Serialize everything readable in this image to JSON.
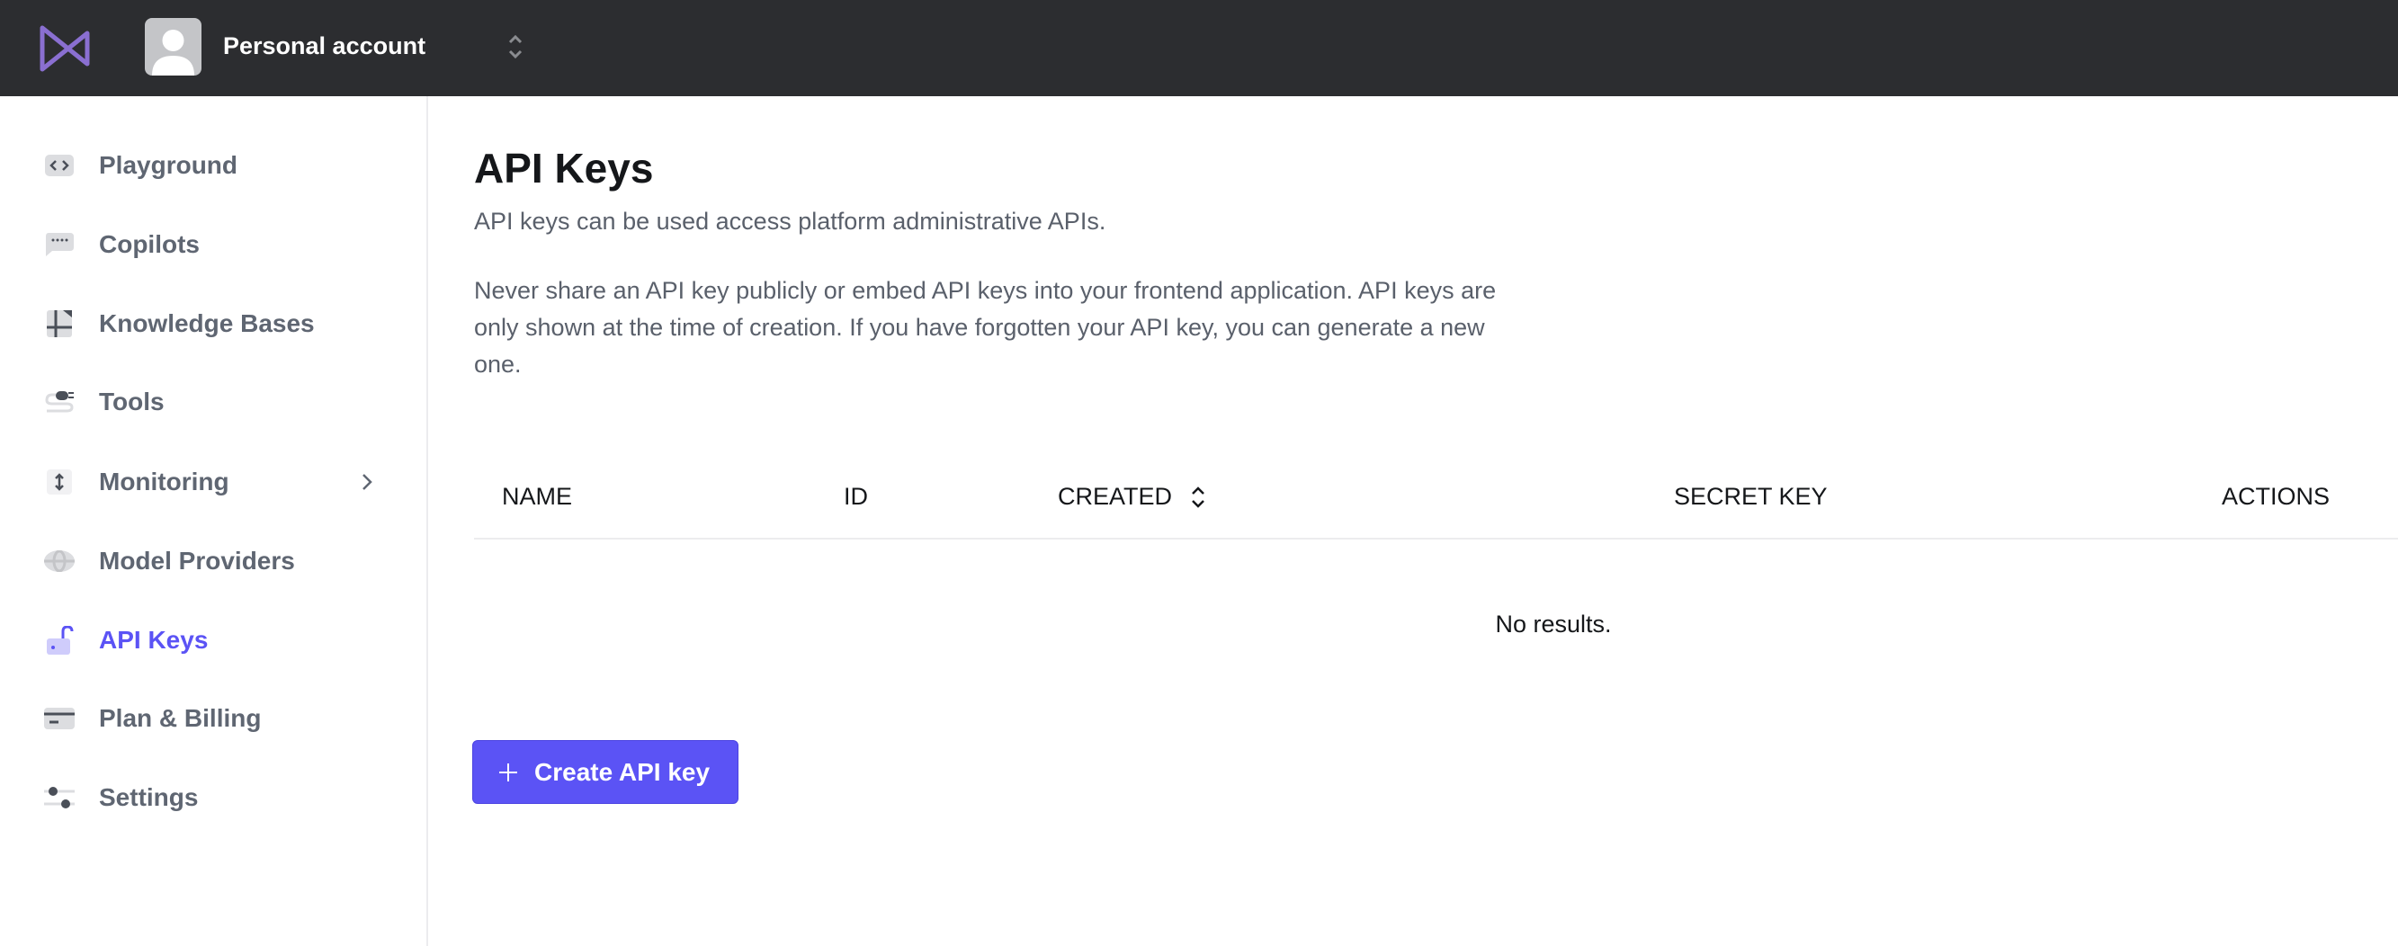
{
  "topbar": {
    "account_name": "Personal account",
    "logo_color": "#8a6fd1"
  },
  "sidebar": {
    "items": [
      {
        "label": "Playground",
        "icon": "code-icon"
      },
      {
        "label": "Copilots",
        "icon": "chat-icon"
      },
      {
        "label": "Knowledge Bases",
        "icon": "book-icon"
      },
      {
        "label": "Tools",
        "icon": "plug-icon"
      },
      {
        "label": "Monitoring",
        "icon": "arrows-icon",
        "has_submenu": true
      },
      {
        "label": "Model Providers",
        "icon": "globe-icon"
      },
      {
        "label": "API Keys",
        "icon": "lock-open-icon",
        "active": true
      },
      {
        "label": "Plan & Billing",
        "icon": "credit-card-icon"
      },
      {
        "label": "Settings",
        "icon": "sliders-icon"
      }
    ]
  },
  "main": {
    "title": "API Keys",
    "subtitle": "API keys can be used access platform administrative APIs.",
    "description": "Never share an API key publicly or embed API keys into your frontend application. API keys are only shown at the time of creation. If you have forgotten your API key, you can generate a new one.",
    "table": {
      "columns": [
        "NAME",
        "ID",
        "CREATED",
        "SECRET KEY",
        "ACTIONS"
      ],
      "empty_text": "No results."
    },
    "create_button": "Create API key"
  },
  "colors": {
    "accent": "#5b53f5",
    "topbar": "#2c2d30",
    "sidebar_text": "#5f6672"
  }
}
